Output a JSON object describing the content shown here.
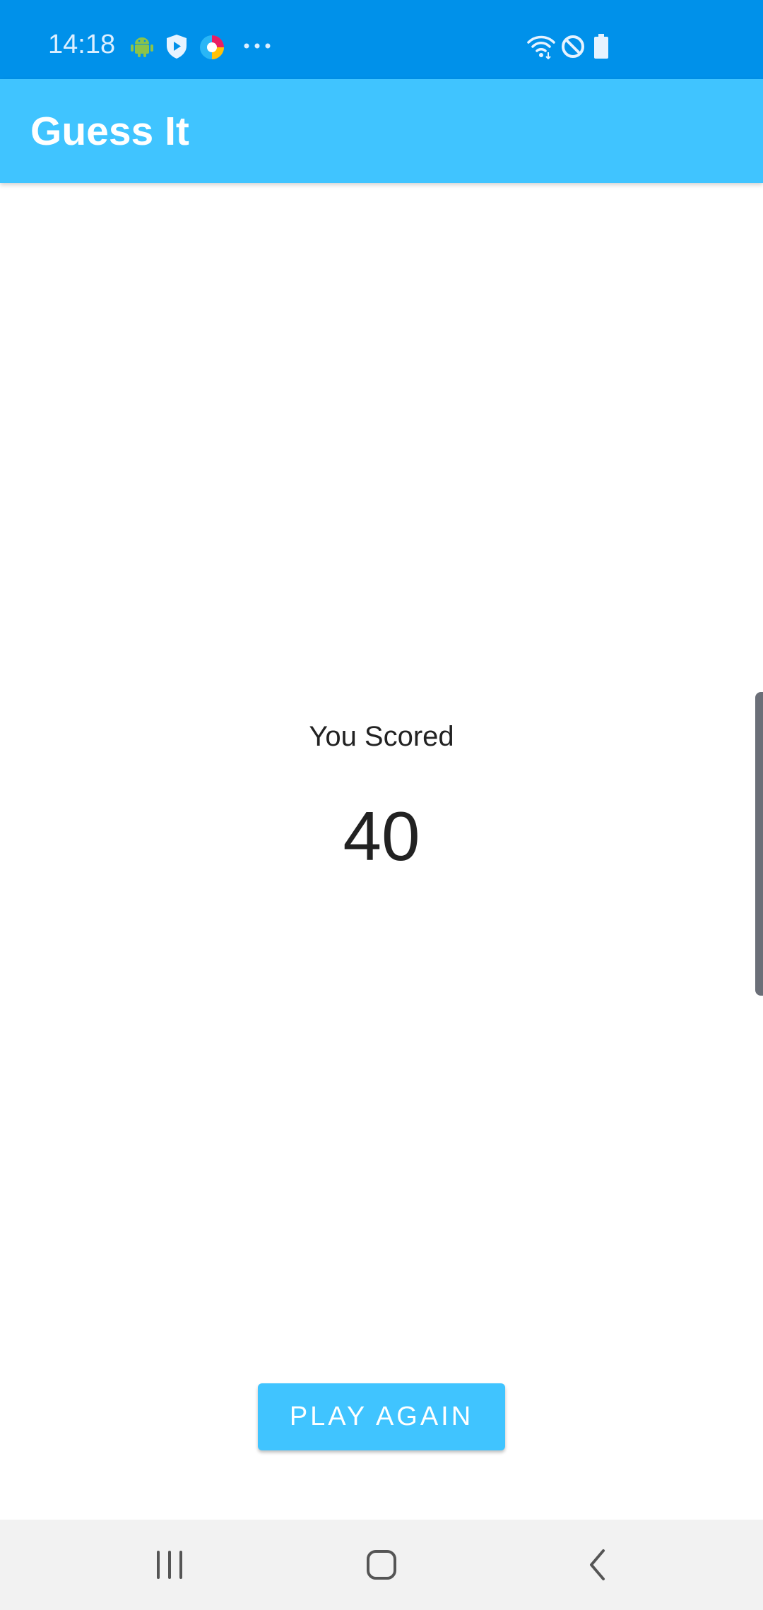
{
  "status_bar": {
    "time": "14:18",
    "left_icons": [
      "android-icon",
      "shield-play-icon",
      "app-circle-icon",
      "more-dots-icon"
    ],
    "right_icons": [
      "wifi-icon",
      "do-not-disturb-icon",
      "battery-icon"
    ],
    "background": "#0091EA"
  },
  "app_bar": {
    "title": "Guess It",
    "background": "#40C4FF"
  },
  "score": {
    "label": "You Scored",
    "value": "40"
  },
  "actions": {
    "play_again_label": "PLAY AGAIN",
    "button_color": "#40C4FF"
  },
  "nav_bar": {
    "buttons": [
      "recent-apps-icon",
      "home-icon",
      "back-icon"
    ]
  }
}
